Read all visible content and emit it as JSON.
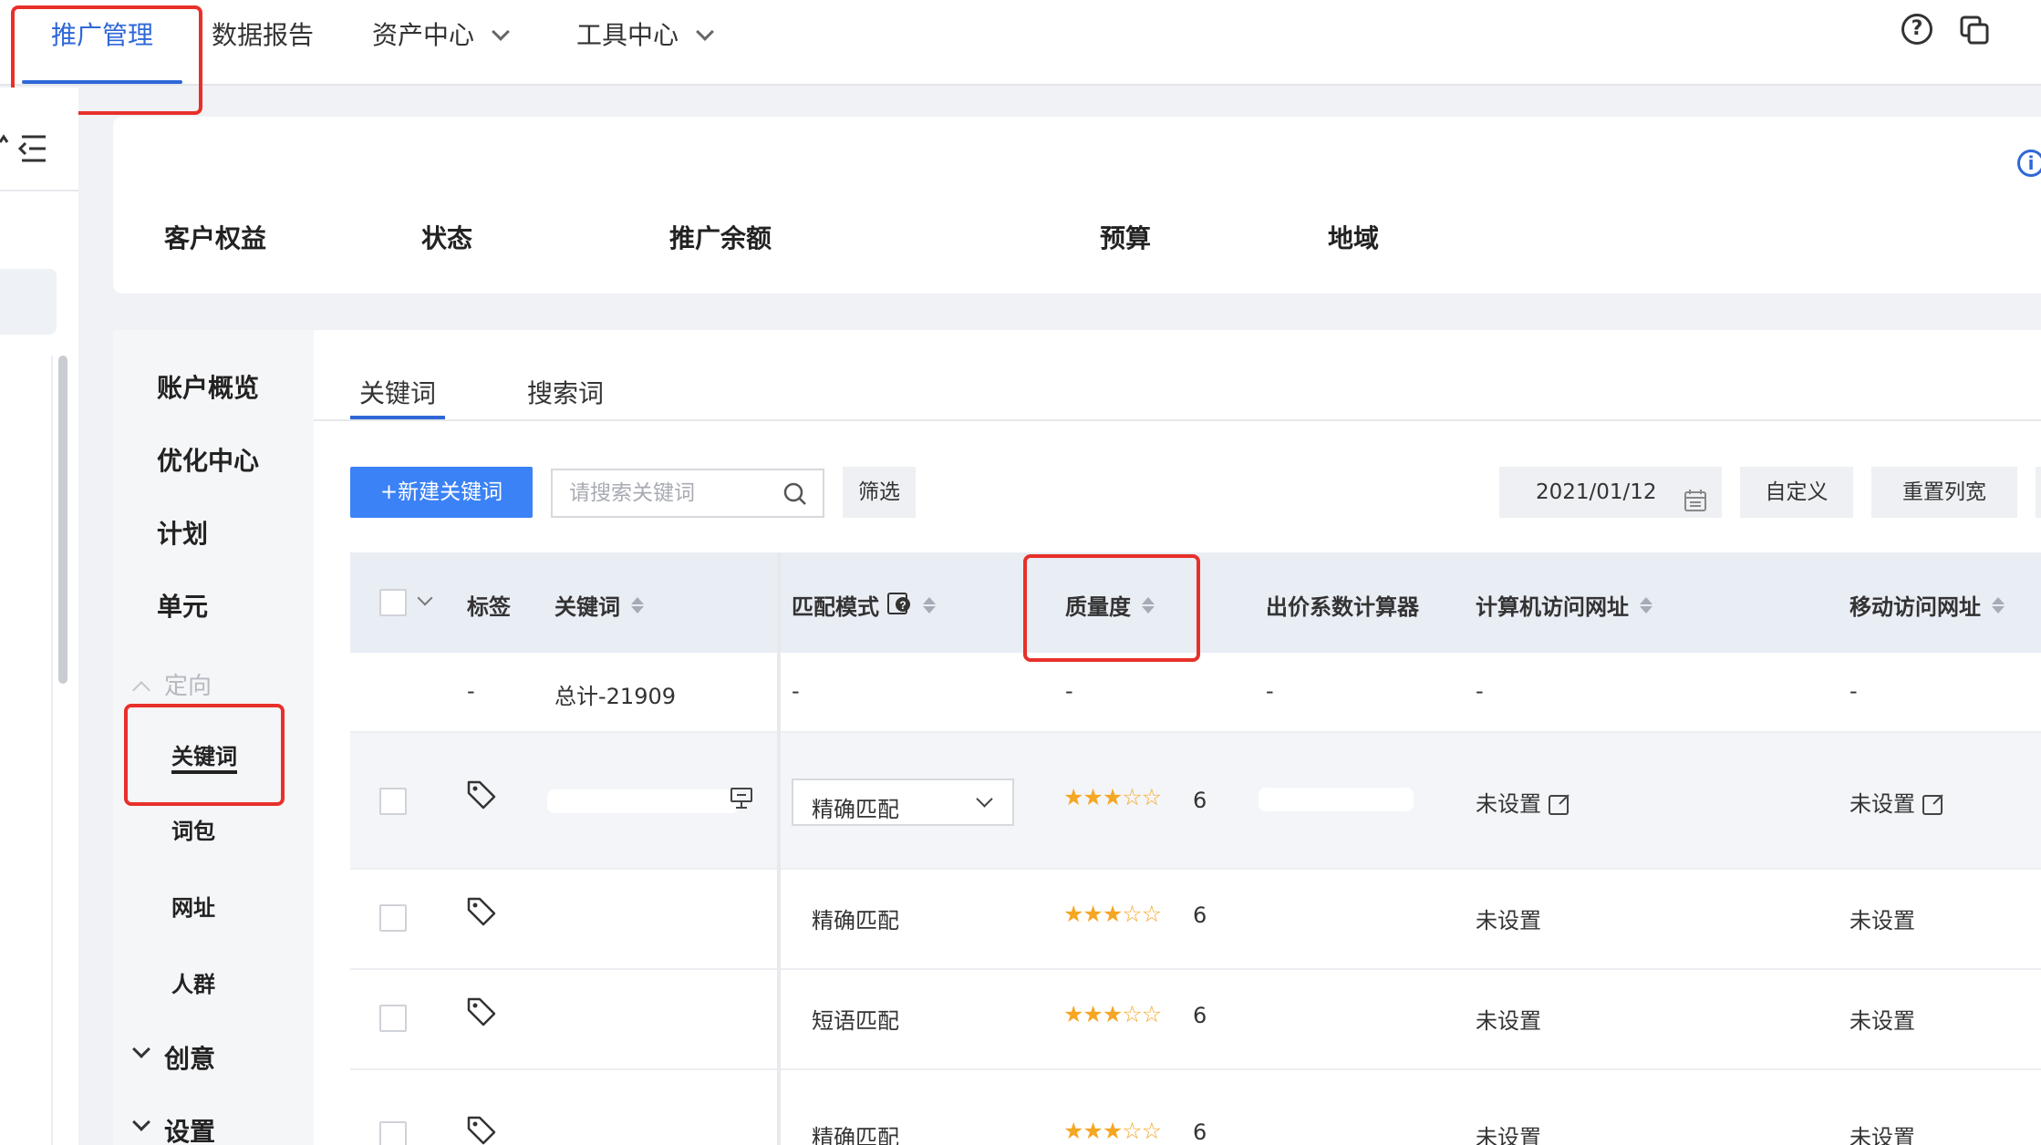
{
  "top_nav": {
    "tabs": [
      {
        "label": "推广管理",
        "active": true
      },
      {
        "label": "数据报告"
      },
      {
        "label": "资产中心"
      },
      {
        "label": "工具中心"
      }
    ],
    "help_icon": "question-circle-icon",
    "switch_icon": "copy-window-icon",
    "accent_color": "#2f67d8",
    "highlight_color": "#e8302a"
  },
  "summary": {
    "labels": [
      "客户权益",
      "状态",
      "推广余额",
      "预算",
      "地域"
    ],
    "info_icon": "i"
  },
  "subnav": {
    "items": [
      {
        "label": "账户概览"
      },
      {
        "label": "优化中心"
      },
      {
        "label": "计划"
      },
      {
        "label": "单元"
      }
    ],
    "targeting": {
      "label": "定向",
      "children": [
        "关键词",
        "词包",
        "网址",
        "人群"
      ]
    },
    "creative": {
      "label": "创意"
    },
    "settings": {
      "label": "设置"
    }
  },
  "main": {
    "tabs": [
      "关键词",
      "搜索词"
    ],
    "toolbar": {
      "new_button": "+新建关键词",
      "search_placeholder": "请搜索关键词",
      "filter_button": "筛选",
      "date": "2021/01/12",
      "custom_button": "自定义",
      "reset_button": "重置列宽"
    },
    "table": {
      "columns": [
        "标签",
        "关键词",
        "匹配模式",
        "质量度",
        "出价系数计算器",
        "计算机访问网址",
        "移动访问网址"
      ],
      "total_row": {
        "tag": "-",
        "keyword": "总计-21909",
        "match": "-",
        "quality": "-",
        "bid": "-",
        "pc_url": "-",
        "mobile_url": "-"
      },
      "rows": [
        {
          "match": "精确匹配",
          "stars": 3,
          "score": "6",
          "pc_url": "未设置",
          "mobile_url": "未设置",
          "editable": true
        },
        {
          "match": "精确匹配",
          "stars": 3,
          "score": "6",
          "pc_url": "未设置",
          "mobile_url": "未设置"
        },
        {
          "match": "短语匹配",
          "stars": 3,
          "score": "6",
          "pc_url": "未设置",
          "mobile_url": "未设置"
        },
        {
          "match": "精确匹配",
          "stars": 3,
          "score": "6",
          "pc_url": "未设置",
          "mobile_url": "未设置"
        }
      ]
    }
  }
}
